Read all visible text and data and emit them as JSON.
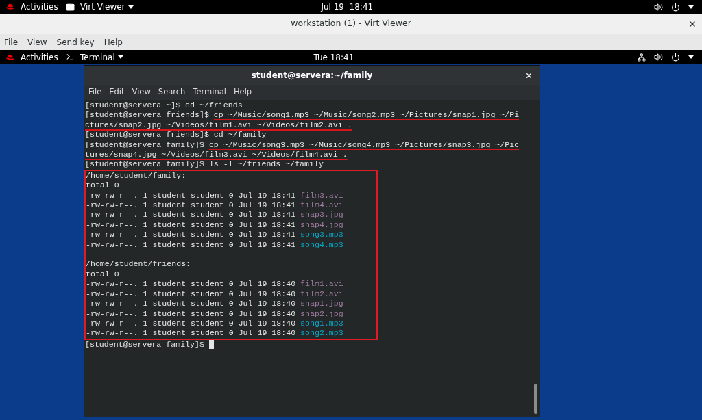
{
  "host_top_bar": {
    "activities": "Activities",
    "app_menu": "Virt Viewer",
    "clock": "Jul 19  18:41"
  },
  "viewer_window": {
    "title": "workstation (1) - Virt Viewer",
    "menu": [
      "File",
      "View",
      "Send key",
      "Help"
    ]
  },
  "guest_top_bar": {
    "activities": "Activities",
    "app_menu": "Terminal",
    "clock": "Tue 18:41"
  },
  "terminal": {
    "title": "student@servera:~/family",
    "menu": [
      "File",
      "Edit",
      "View",
      "Search",
      "Terminal",
      "Help"
    ],
    "lines": [
      {
        "kind": "prompt",
        "prompt": "[student@servera ~]$",
        "command": "cd ~/friends",
        "underlined": false
      },
      {
        "kind": "prompt",
        "prompt": "[student@servera friends]$",
        "command": "cp ~/Music/song1.mp3 ~/Music/song2.mp3 ~/Pictures/snap1.jpg ~/Pi",
        "underlined": true
      },
      {
        "kind": "wrap",
        "text": "ctures/snap2.jpg ~/Videos/film1.avi ~/Videos/film2.avi .",
        "underlined": true
      },
      {
        "kind": "prompt",
        "prompt": "[student@servera friends]$",
        "command": "cd ~/family",
        "underlined": false
      },
      {
        "kind": "prompt",
        "prompt": "[student@servera family]$",
        "command": "cp ~/Music/song3.mp3 ~/Music/song4.mp3 ~/Pictures/snap3.jpg ~/Pic",
        "underlined": true
      },
      {
        "kind": "wrap",
        "text": "tures/snap4.jpg ~/Videos/film3.avi ~/Videos/film4.avi .",
        "underlined": true
      },
      {
        "kind": "prompt",
        "prompt": "[student@servera family]$",
        "command": "ls -l ~/friends ~/family",
        "underlined": false
      }
    ],
    "highlighted_output": [
      {
        "kind": "text",
        "text": "/home/student/family:"
      },
      {
        "kind": "text",
        "text": "total 0"
      },
      {
        "kind": "file",
        "details": "-rw-rw-r--. 1 student student 0 Jul 19 18:41",
        "name": "film3.avi",
        "color": "#a07ba0"
      },
      {
        "kind": "file",
        "details": "-rw-rw-r--. 1 student student 0 Jul 19 18:41",
        "name": "film4.avi",
        "color": "#a07ba0"
      },
      {
        "kind": "file",
        "details": "-rw-rw-r--. 1 student student 0 Jul 19 18:41",
        "name": "snap3.jpg",
        "color": "#a07ba0"
      },
      {
        "kind": "file",
        "details": "-rw-rw-r--. 1 student student 0 Jul 19 18:41",
        "name": "snap4.jpg",
        "color": "#a07ba0"
      },
      {
        "kind": "file",
        "details": "-rw-rw-r--. 1 student student 0 Jul 19 18:41",
        "name": "song3.mp3",
        "color": "#06a8c8"
      },
      {
        "kind": "file",
        "details": "-rw-rw-r--. 1 student student 0 Jul 19 18:41",
        "name": "song4.mp3",
        "color": "#06a8c8"
      },
      {
        "kind": "blank"
      },
      {
        "kind": "text",
        "text": "/home/student/friends:"
      },
      {
        "kind": "text",
        "text": "total 0"
      },
      {
        "kind": "file",
        "details": "-rw-rw-r--. 1 student student 0 Jul 19 18:40",
        "name": "film1.avi",
        "color": "#a07ba0"
      },
      {
        "kind": "file",
        "details": "-rw-rw-r--. 1 student student 0 Jul 19 18:40",
        "name": "film2.avi",
        "color": "#a07ba0"
      },
      {
        "kind": "file",
        "details": "-rw-rw-r--. 1 student student 0 Jul 19 18:40",
        "name": "snap1.jpg",
        "color": "#a07ba0"
      },
      {
        "kind": "file",
        "details": "-rw-rw-r--. 1 student student 0 Jul 19 18:40",
        "name": "snap2.jpg",
        "color": "#a07ba0"
      },
      {
        "kind": "file",
        "details": "-rw-rw-r--. 1 student student 0 Jul 19 18:40",
        "name": "song1.mp3",
        "color": "#06a8c8"
      },
      {
        "kind": "file",
        "details": "-rw-rw-r--. 1 student student 0 Jul 19 18:40",
        "name": "song2.mp3",
        "color": "#06a8c8"
      }
    ],
    "final_prompt": {
      "prompt": "[student@servera family]$",
      "cursor": true
    }
  }
}
